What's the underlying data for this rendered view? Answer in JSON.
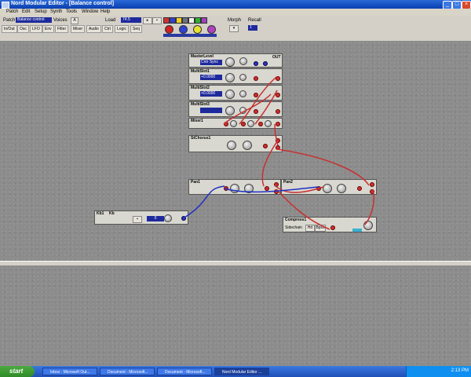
{
  "window": {
    "title": "Nord Modular Editor - [Balance control]"
  },
  "menu": [
    "Patch",
    "Edit",
    "Setup",
    "Synth",
    "Tools",
    "Window",
    "Help"
  ],
  "toolbar": {
    "patch_label": "Patch",
    "patch_name": "Balance control",
    "voices_label": "Voices",
    "slot_a": "A",
    "load_label": "Load",
    "load_value": "74.5",
    "cable_colors": [
      "#d03030",
      "#3040d0",
      "#f0d020",
      "#70707a",
      "#f0f0f0",
      "#30b030",
      "#a040c0"
    ],
    "tabs": [
      "In/Out",
      "Osc",
      "LFO",
      "Env",
      "Filter",
      "Mixer",
      "Audio",
      "Ctrl",
      "Logic",
      "Seq"
    ],
    "morph_label": "Morph",
    "morph_value": "1",
    "knob_colors": [
      "#d02020",
      "#3040d0",
      "#e8e030",
      "#b040c0"
    ]
  },
  "modules": {
    "master_level": {
      "title": "MasterLevel",
      "display": "Cntr Sync",
      "out_label": "OUT"
    },
    "level1": {
      "title": "MultiSlot1",
      "display": "+0.0000"
    },
    "level2": {
      "title": "MultiSlot2",
      "display": "+0.0000"
    },
    "level3": {
      "title": "MultiSlot3",
      "display": ""
    },
    "mixer": {
      "title": "Mixer1"
    },
    "stereo": {
      "title": "StChorus1"
    },
    "pan1": {
      "title": "Pan1"
    },
    "pan2": {
      "title": "Pan2"
    },
    "kb": {
      "title": "Kb1",
      "title2": "Kb",
      "value": "0"
    },
    "compressor": {
      "title": "Compress1",
      "sub": "Sidechain",
      "btns": [
        "Hd",
        "Bpss"
      ]
    }
  },
  "taskbar": {
    "start": "start",
    "tasks": [
      "Inbox - Microsoft Out...",
      "Document - Microsoft...",
      "Document - Microsoft...",
      "Nord Modular Editor ..."
    ],
    "clock": "2:13 PM"
  }
}
